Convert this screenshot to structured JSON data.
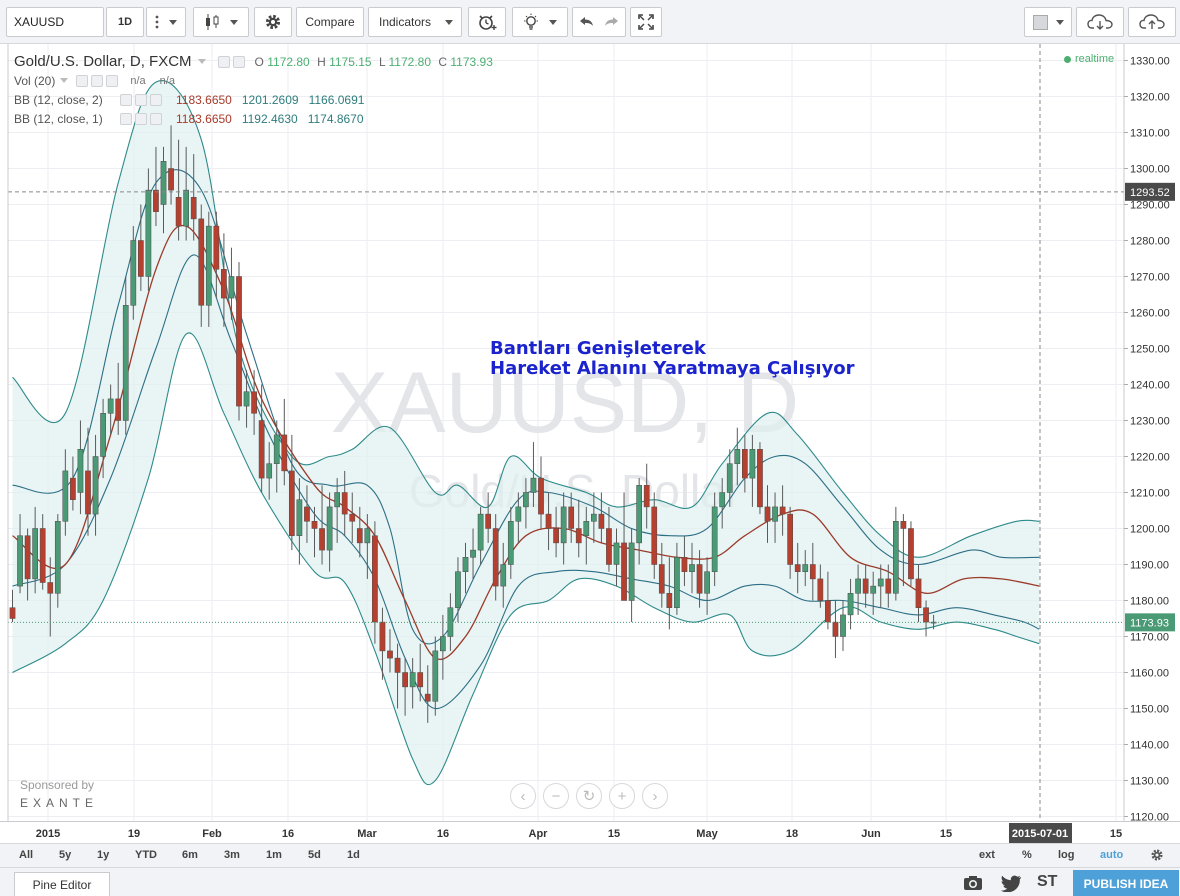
{
  "toolbar": {
    "symbol": "XAUUSD",
    "interval": "1D",
    "compare_label": "Compare",
    "indicators_label": "Indicators"
  },
  "legend": {
    "title": "Gold/U.S. Dollar, D, FXCM",
    "ohlc": {
      "o_label": "O",
      "o": "1172.80",
      "h_label": "H",
      "h": "1175.15",
      "l_label": "L",
      "l": "1172.80",
      "c_label": "C",
      "c": "1173.93"
    },
    "vol": {
      "name": "Vol (20)",
      "v1": "n/a",
      "v2": "n/a"
    },
    "bb1": {
      "name": "BB (12, close, 2)",
      "mid": "1183.6650",
      "up": "1201.2609",
      "low": "1166.0691"
    },
    "bb2": {
      "name": "BB (12, close, 1)",
      "mid": "1183.6650",
      "up": "1192.4630",
      "low": "1174.8670"
    }
  },
  "realtime_label": "realtime",
  "watermark": {
    "line1": "XAUUSD, D",
    "line2": "Gold/U.S. Dollar"
  },
  "annotation": {
    "line1": "Bantları Genişleterek",
    "line2": "Hareket Alanını Yaratmaya Çalışıyor"
  },
  "sponsor": {
    "line1": "Sponsored by",
    "line2": "EXANTE"
  },
  "price_axis": {
    "ticks": [
      "1330.00",
      "1320.00",
      "1310.00",
      "1300.00",
      "1290.00",
      "1280.00",
      "1270.00",
      "1260.00",
      "1250.00",
      "1240.00",
      "1230.00",
      "1220.00",
      "1210.00",
      "1200.00",
      "1190.00",
      "1180.00",
      "1170.00",
      "1160.00",
      "1150.00",
      "1140.00",
      "1130.00",
      "1120.00"
    ],
    "crosshair_label": "1293.52",
    "last_label": "1173.93"
  },
  "time_axis": {
    "ticks": [
      "2015",
      "19",
      "Feb",
      "16",
      "Mar",
      "16",
      "Apr",
      "15",
      "May",
      "18",
      "Jun",
      "15",
      "15"
    ],
    "crosshair_label": "2015-07-01"
  },
  "range_bar": {
    "left": [
      "All",
      "5y",
      "1y",
      "YTD",
      "6m",
      "3m",
      "1m",
      "5d",
      "1d"
    ],
    "right": [
      "ext",
      "%",
      "log",
      "auto"
    ]
  },
  "bottom": {
    "pine_editor": "Pine Editor",
    "st": "ST",
    "publish": "PUBLISH IDEA"
  },
  "colors": {
    "up": "#4a9a75",
    "down": "#b5402f",
    "bb_outer": "#2e8a8a",
    "bb_inner": "#2c6f86",
    "basis": "#9b3b2a",
    "fill": "#dff0f0",
    "annotation": "#1a23cc",
    "publish": "#4ea0d8"
  },
  "chart_data": {
    "type": "candlestick",
    "symbol": "XAUUSD",
    "ylim": [
      1120,
      1330
    ],
    "crosshair_price": 1293.52,
    "last_price": 1173.93,
    "candles": [
      [
        1178,
        1183,
        1174,
        1175
      ],
      [
        1184,
        1204,
        1182,
        1198
      ],
      [
        1198,
        1200,
        1180,
        1186
      ],
      [
        1186,
        1206,
        1182,
        1200
      ],
      [
        1200,
        1204,
        1183,
        1185
      ],
      [
        1185,
        1192,
        1170,
        1182
      ],
      [
        1182,
        1204,
        1178,
        1202
      ],
      [
        1202,
        1222,
        1198,
        1216
      ],
      [
        1214,
        1220,
        1205,
        1208
      ],
      [
        1210,
        1230,
        1204,
        1222
      ],
      [
        1216,
        1228,
        1198,
        1204
      ],
      [
        1204,
        1226,
        1198,
        1220
      ],
      [
        1220,
        1236,
        1214,
        1232
      ],
      [
        1232,
        1240,
        1226,
        1236
      ],
      [
        1236,
        1246,
        1226,
        1230
      ],
      [
        1230,
        1270,
        1226,
        1262
      ],
      [
        1262,
        1284,
        1258,
        1280
      ],
      [
        1280,
        1290,
        1266,
        1270
      ],
      [
        1270,
        1300,
        1266,
        1294
      ],
      [
        1294,
        1306,
        1284,
        1288
      ],
      [
        1290,
        1306,
        1282,
        1302
      ],
      [
        1300,
        1312,
        1290,
        1294
      ],
      [
        1292,
        1308,
        1280,
        1284
      ],
      [
        1284,
        1306,
        1280,
        1294
      ],
      [
        1292,
        1304,
        1280,
        1286
      ],
      [
        1286,
        1290,
        1256,
        1262
      ],
      [
        1262,
        1288,
        1256,
        1284
      ],
      [
        1284,
        1288,
        1264,
        1272
      ],
      [
        1272,
        1282,
        1256,
        1264
      ],
      [
        1264,
        1278,
        1258,
        1270
      ],
      [
        1270,
        1274,
        1230,
        1234
      ],
      [
        1234,
        1244,
        1228,
        1238
      ],
      [
        1238,
        1244,
        1226,
        1232
      ],
      [
        1230,
        1240,
        1210,
        1214
      ],
      [
        1214,
        1224,
        1208,
        1218
      ],
      [
        1218,
        1230,
        1210,
        1226
      ],
      [
        1226,
        1236,
        1212,
        1216
      ],
      [
        1216,
        1226,
        1194,
        1198
      ],
      [
        1198,
        1214,
        1190,
        1208
      ],
      [
        1206,
        1212,
        1196,
        1202
      ],
      [
        1202,
        1206,
        1192,
        1200
      ],
      [
        1200,
        1212,
        1190,
        1194
      ],
      [
        1194,
        1210,
        1188,
        1206
      ],
      [
        1206,
        1214,
        1196,
        1210
      ],
      [
        1210,
        1216,
        1198,
        1204
      ],
      [
        1204,
        1210,
        1196,
        1202
      ],
      [
        1200,
        1206,
        1192,
        1196
      ],
      [
        1196,
        1204,
        1186,
        1200
      ],
      [
        1198,
        1202,
        1168,
        1174
      ],
      [
        1174,
        1178,
        1158,
        1166
      ],
      [
        1166,
        1172,
        1160,
        1164
      ],
      [
        1164,
        1168,
        1150,
        1160
      ],
      [
        1160,
        1164,
        1148,
        1156
      ],
      [
        1156,
        1164,
        1150,
        1160
      ],
      [
        1160,
        1168,
        1152,
        1156
      ],
      [
        1154,
        1162,
        1146,
        1152
      ],
      [
        1152,
        1170,
        1148,
        1166
      ],
      [
        1166,
        1176,
        1158,
        1170
      ],
      [
        1170,
        1182,
        1166,
        1178
      ],
      [
        1178,
        1192,
        1174,
        1188
      ],
      [
        1188,
        1196,
        1182,
        1192
      ],
      [
        1192,
        1200,
        1186,
        1194
      ],
      [
        1194,
        1206,
        1190,
        1204
      ],
      [
        1204,
        1210,
        1196,
        1200
      ],
      [
        1200,
        1204,
        1180,
        1184
      ],
      [
        1184,
        1196,
        1178,
        1190
      ],
      [
        1190,
        1206,
        1186,
        1202
      ],
      [
        1202,
        1210,
        1196,
        1206
      ],
      [
        1206,
        1214,
        1200,
        1210
      ],
      [
        1210,
        1224,
        1206,
        1214
      ],
      [
        1214,
        1220,
        1200,
        1204
      ],
      [
        1204,
        1210,
        1194,
        1200
      ],
      [
        1200,
        1206,
        1192,
        1196
      ],
      [
        1196,
        1210,
        1190,
        1206
      ],
      [
        1206,
        1210,
        1196,
        1200
      ],
      [
        1200,
        1208,
        1192,
        1196
      ],
      [
        1198,
        1206,
        1190,
        1202
      ],
      [
        1202,
        1210,
        1196,
        1204
      ],
      [
        1204,
        1210,
        1196,
        1200
      ],
      [
        1200,
        1206,
        1188,
        1190
      ],
      [
        1190,
        1200,
        1184,
        1196
      ],
      [
        1196,
        1210,
        1180,
        1180
      ],
      [
        1180,
        1200,
        1174,
        1196
      ],
      [
        1196,
        1214,
        1190,
        1212
      ],
      [
        1212,
        1218,
        1200,
        1206
      ],
      [
        1206,
        1210,
        1186,
        1190
      ],
      [
        1190,
        1196,
        1178,
        1182
      ],
      [
        1182,
        1192,
        1172,
        1178
      ],
      [
        1178,
        1196,
        1176,
        1192
      ],
      [
        1192,
        1198,
        1184,
        1188
      ],
      [
        1188,
        1196,
        1182,
        1190
      ],
      [
        1190,
        1194,
        1178,
        1182
      ],
      [
        1182,
        1192,
        1176,
        1188
      ],
      [
        1188,
        1210,
        1184,
        1206
      ],
      [
        1206,
        1214,
        1200,
        1210
      ],
      [
        1210,
        1222,
        1206,
        1218
      ],
      [
        1218,
        1228,
        1212,
        1222
      ],
      [
        1222,
        1226,
        1210,
        1214
      ],
      [
        1214,
        1226,
        1206,
        1222
      ],
      [
        1222,
        1224,
        1204,
        1206
      ],
      [
        1206,
        1212,
        1196,
        1202
      ],
      [
        1202,
        1210,
        1196,
        1206
      ],
      [
        1206,
        1212,
        1198,
        1204
      ],
      [
        1204,
        1206,
        1186,
        1190
      ],
      [
        1190,
        1196,
        1182,
        1188
      ],
      [
        1188,
        1194,
        1184,
        1190
      ],
      [
        1190,
        1196,
        1180,
        1186
      ],
      [
        1186,
        1190,
        1178,
        1180
      ],
      [
        1180,
        1188,
        1172,
        1174
      ],
      [
        1174,
        1180,
        1164,
        1170
      ],
      [
        1170,
        1180,
        1166,
        1176
      ],
      [
        1176,
        1186,
        1172,
        1182
      ],
      [
        1182,
        1190,
        1176,
        1186
      ],
      [
        1186,
        1190,
        1178,
        1182
      ],
      [
        1182,
        1188,
        1176,
        1184
      ],
      [
        1184,
        1190,
        1178,
        1186
      ],
      [
        1186,
        1190,
        1178,
        1182
      ],
      [
        1182,
        1206,
        1180,
        1202
      ],
      [
        1202,
        1204,
        1184,
        1200
      ],
      [
        1200,
        1202,
        1184,
        1186
      ],
      [
        1186,
        1190,
        1174,
        1178
      ],
      [
        1178,
        1180,
        1170,
        1174
      ],
      [
        1174,
        1176,
        1172,
        1174
      ]
    ],
    "bb_outer": {
      "upper": [
        [
          0,
          1242
        ],
        [
          7,
          1232
        ],
        [
          14,
          1296
        ],
        [
          19,
          1324
        ],
        [
          25,
          1308
        ],
        [
          30,
          1250
        ],
        [
          37,
          1220
        ],
        [
          42,
          1220
        ],
        [
          45,
          1222
        ],
        [
          50,
          1228
        ],
        [
          56,
          1210
        ],
        [
          59,
          1212
        ],
        [
          63,
          1206
        ],
        [
          66,
          1220
        ],
        [
          70,
          1214
        ],
        [
          76,
          1210
        ],
        [
          80,
          1206
        ],
        [
          85,
          1208
        ],
        [
          90,
          1206
        ],
        [
          94,
          1218
        ],
        [
          100,
          1232
        ],
        [
          104,
          1226
        ],
        [
          110,
          1210
        ],
        [
          115,
          1198
        ],
        [
          120,
          1192
        ],
        [
          127,
          1198
        ],
        [
          133,
          1202
        ],
        [
          136,
          1202
        ]
      ],
      "lower": [
        [
          0,
          1160
        ],
        [
          7,
          1168
        ],
        [
          12,
          1180
        ],
        [
          18,
          1214
        ],
        [
          23,
          1254
        ],
        [
          28,
          1232
        ],
        [
          33,
          1210
        ],
        [
          40,
          1188
        ],
        [
          44,
          1185
        ],
        [
          48,
          1166
        ],
        [
          53,
          1136
        ],
        [
          56,
          1130
        ],
        [
          61,
          1154
        ],
        [
          66,
          1176
        ],
        [
          71,
          1180
        ],
        [
          75,
          1186
        ],
        [
          80,
          1184
        ],
        [
          85,
          1178
        ],
        [
          90,
          1174
        ],
        [
          95,
          1176
        ],
        [
          98,
          1166
        ],
        [
          103,
          1166
        ],
        [
          110,
          1178
        ],
        [
          115,
          1174
        ],
        [
          120,
          1172
        ],
        [
          125,
          1174
        ],
        [
          130,
          1172
        ],
        [
          133,
          1170
        ],
        [
          136,
          1168
        ]
      ]
    },
    "bb_inner": {
      "upper": [
        [
          0,
          1212
        ],
        [
          8,
          1214
        ],
        [
          14,
          1262
        ],
        [
          19,
          1296
        ],
        [
          25,
          1294
        ],
        [
          31,
          1254
        ],
        [
          37,
          1218
        ],
        [
          42,
          1212
        ],
        [
          47,
          1212
        ],
        [
          50,
          1200
        ],
        [
          53,
          1172
        ],
        [
          57,
          1170
        ],
        [
          62,
          1190
        ],
        [
          67,
          1208
        ],
        [
          71,
          1210
        ],
        [
          77,
          1206
        ],
        [
          82,
          1200
        ],
        [
          87,
          1198
        ],
        [
          92,
          1200
        ],
        [
          97,
          1214
        ],
        [
          101,
          1220
        ],
        [
          105,
          1218
        ],
        [
          110,
          1206
        ],
        [
          115,
          1194
        ],
        [
          120,
          1190
        ],
        [
          127,
          1194
        ],
        [
          131,
          1192
        ],
        [
          136,
          1192
        ]
      ],
      "lower": [
        [
          0,
          1184
        ],
        [
          7,
          1190
        ],
        [
          13,
          1214
        ],
        [
          19,
          1250
        ],
        [
          24,
          1276
        ],
        [
          29,
          1252
        ],
        [
          34,
          1226
        ],
        [
          40,
          1204
        ],
        [
          44,
          1198
        ],
        [
          48,
          1186
        ],
        [
          52,
          1164
        ],
        [
          56,
          1150
        ],
        [
          62,
          1162
        ],
        [
          67,
          1184
        ],
        [
          72,
          1188
        ],
        [
          77,
          1188
        ],
        [
          82,
          1186
        ],
        [
          87,
          1184
        ],
        [
          92,
          1180
        ],
        [
          97,
          1184
        ],
        [
          101,
          1184
        ],
        [
          105,
          1180
        ],
        [
          110,
          1180
        ],
        [
          115,
          1178
        ],
        [
          120,
          1176
        ],
        [
          125,
          1178
        ],
        [
          130,
          1176
        ],
        [
          134,
          1174
        ],
        [
          136,
          1172
        ]
      ]
    },
    "basis": [
      [
        0,
        1198
      ],
      [
        7,
        1190
      ],
      [
        13,
        1226
      ],
      [
        19,
        1272
      ],
      [
        23,
        1284
      ],
      [
        28,
        1266
      ],
      [
        33,
        1236
      ],
      [
        40,
        1212
      ],
      [
        44,
        1206
      ],
      [
        48,
        1198
      ],
      [
        52,
        1180
      ],
      [
        56,
        1164
      ],
      [
        60,
        1170
      ],
      [
        64,
        1186
      ],
      [
        68,
        1198
      ],
      [
        73,
        1200
      ],
      [
        78,
        1196
      ],
      [
        83,
        1194
      ],
      [
        88,
        1192
      ],
      [
        93,
        1192
      ],
      [
        97,
        1198
      ],
      [
        102,
        1204
      ],
      [
        106,
        1204
      ],
      [
        111,
        1192
      ],
      [
        116,
        1188
      ],
      [
        121,
        1182
      ],
      [
        126,
        1186
      ],
      [
        131,
        1186
      ],
      [
        136,
        1184
      ]
    ]
  }
}
